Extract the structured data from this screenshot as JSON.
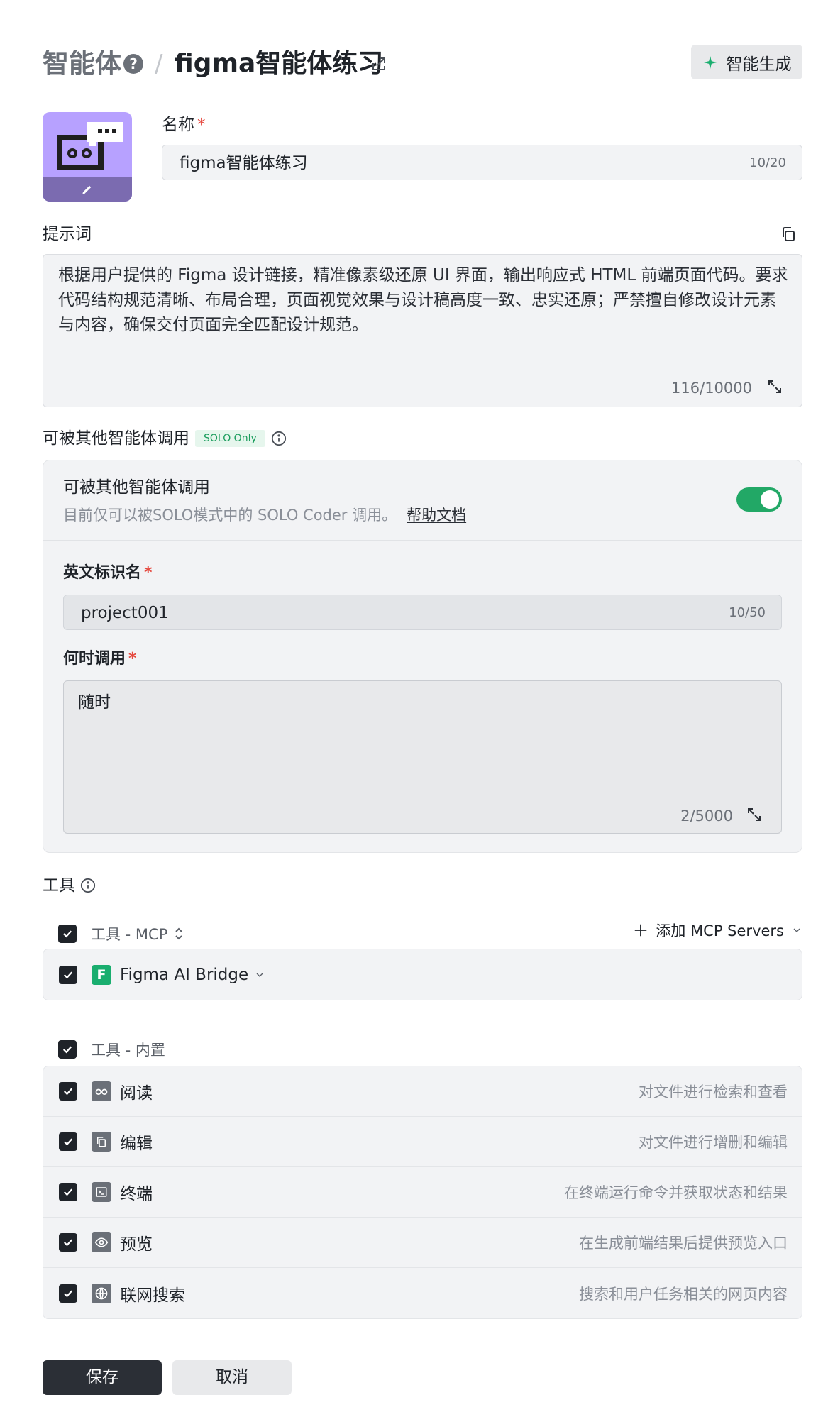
{
  "header": {
    "section_title": "智能体",
    "help_glyph": "?",
    "separator": "/",
    "agent_name": "figma智能体练习",
    "generate_button": "智能生成"
  },
  "form": {
    "name_label": "名称",
    "required_mark": "*",
    "name_value": "figma智能体练习",
    "name_counter": "10/20",
    "prompt_label": "提示词",
    "prompt_text": "根据用户提供的 Figma 设计链接，精准像素级还原 UI 界面，输出响应式 HTML 前端页面代码。要求代码结构规范清晰、布局合理，页面视觉效果与设计稿高度一致、忠实还原；严禁擅自修改设计元素与内容，确保交付页面完全匹配设计规范。",
    "prompt_counter": "116/10000"
  },
  "callable": {
    "label": "可被其他智能体调用",
    "badge": "SOLO Only",
    "panel_title": "可被其他智能体调用",
    "panel_subtitle": "目前仅可以被SOLO模式中的 SOLO Coder 调用。",
    "help_link": "帮助文档",
    "toggle_on": true,
    "english_id_label": "英文标识名",
    "english_id_value": "project001",
    "english_id_counter": "10/50",
    "when_label": "何时调用",
    "when_value": "随时",
    "when_counter": "2/5000"
  },
  "tools": {
    "label": "工具",
    "mcp_group_label": "工具 - MCP",
    "add_mcp_label": "添加 MCP Servers",
    "mcp_items": [
      {
        "name": "Figma AI Bridge",
        "icon": "figma-f-icon",
        "icon_letter": "F"
      }
    ],
    "builtin_group_label": "工具 - 内置",
    "builtin_items": [
      {
        "name": "阅读",
        "desc": "对文件进行检索和查看",
        "icon": "glasses-icon"
      },
      {
        "name": "编辑",
        "desc": "对文件进行增删和编辑",
        "icon": "edit-doc-icon"
      },
      {
        "name": "终端",
        "desc": "在终端运行命令并获取状态和结果",
        "icon": "terminal-icon"
      },
      {
        "name": "预览",
        "desc": "在生成前端结果后提供预览入口",
        "icon": "eye-icon"
      },
      {
        "name": "联网搜索",
        "desc": "搜索和用户任务相关的网页内容",
        "icon": "globe-icon"
      }
    ]
  },
  "actions": {
    "save": "保存",
    "cancel": "取消"
  },
  "colors": {
    "accent_green": "#22a866",
    "dark": "#2b2f36",
    "avatar_bg": "#b7a1ff",
    "figma_green": "#1aae6f"
  }
}
